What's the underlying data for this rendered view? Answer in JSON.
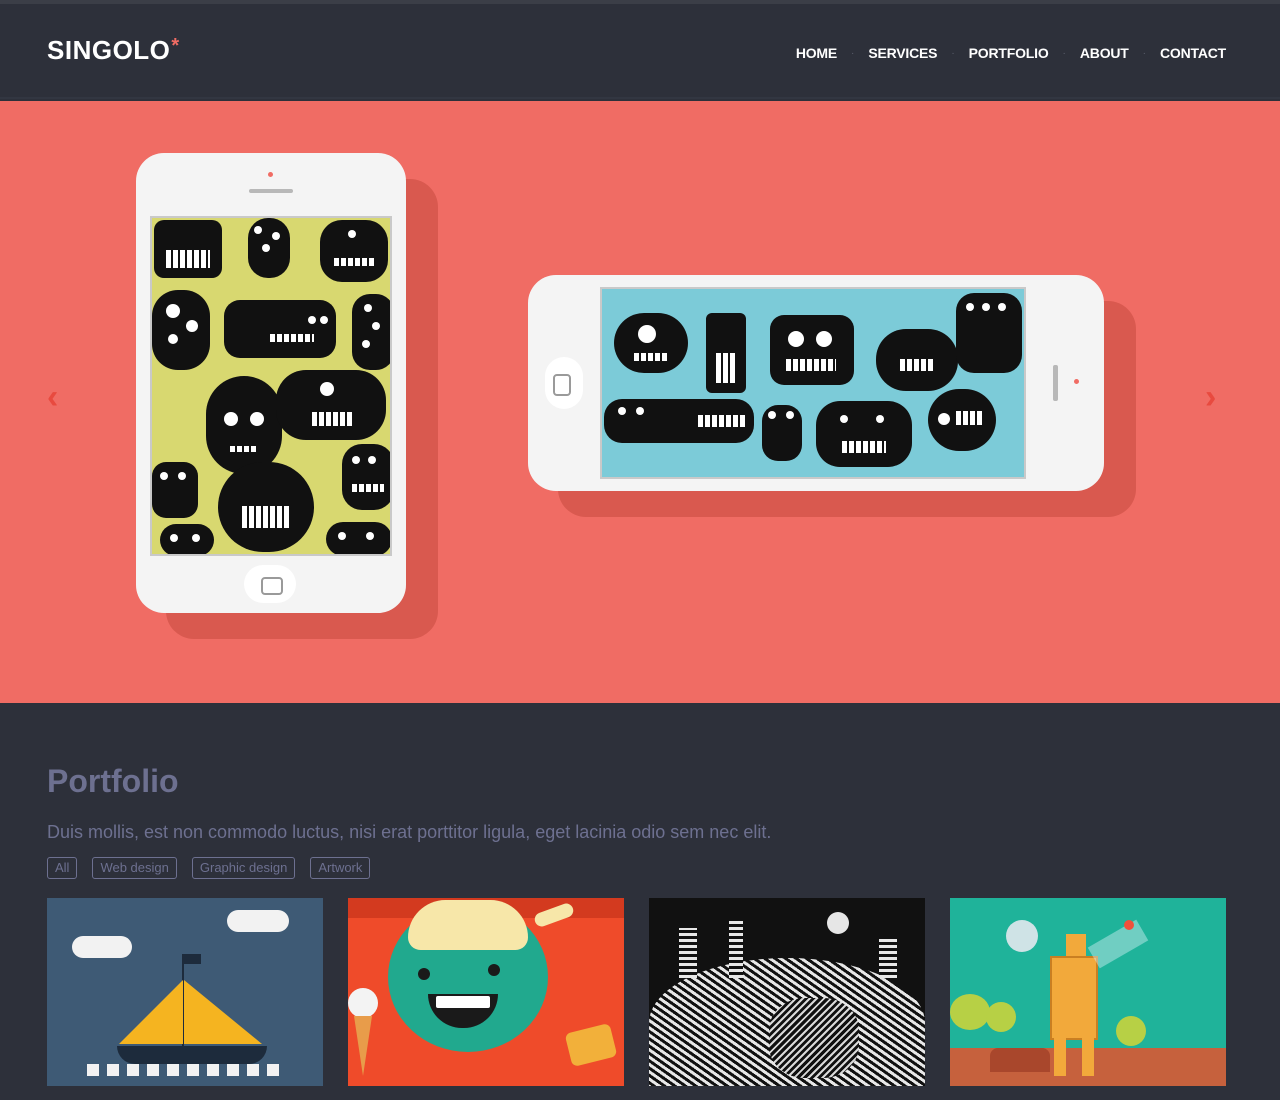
{
  "header": {
    "logo": "SINGOLO",
    "logo_mark": "*",
    "nav": [
      "HOME",
      "SERVICES",
      "PORTFOLIO",
      "ABOUT",
      "CONTACT"
    ],
    "separator": "·"
  },
  "slider": {
    "prev_icon": "chevron-left-icon",
    "next_icon": "chevron-right-icon",
    "prev_glyph": "‹",
    "next_glyph": "›",
    "colors": {
      "background": "#f06c64",
      "phone": "#f4f4f4",
      "screen_yellow": "#d8d870",
      "screen_blue": "#7ccbd8"
    }
  },
  "portfolio": {
    "title": "Portfolio",
    "description": "Duis mollis, est non commodo luctus, nisi erat porttitor ligula, eget lacinia odio sem nec elit.",
    "filters": [
      "All",
      "Web design",
      "Graphic design",
      "Artwork"
    ],
    "items": [
      "sailboat",
      "girl-with-ice-cream",
      "city-drawing",
      "robot"
    ]
  }
}
